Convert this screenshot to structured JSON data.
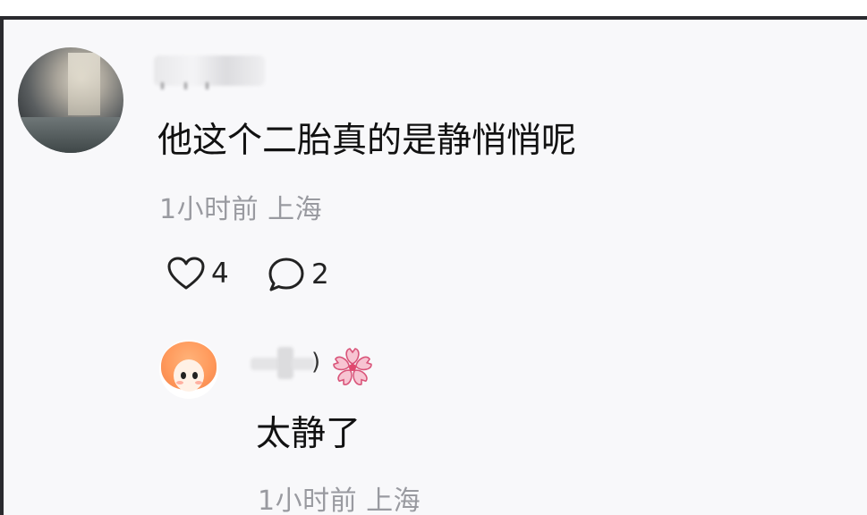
{
  "comment": {
    "text": "他这个二胎真的是静悄悄呢",
    "meta": "1小时前 上海",
    "likes": "4",
    "replies": "2",
    "avatar_icon": "photo-avatar",
    "like_icon": "heart-outline-icon",
    "reply_icon": "speech-bubble-icon"
  },
  "reply": {
    "text": "太静了",
    "meta": "1小时前 上海",
    "avatar_icon": "anime-girl-avatar",
    "badge_icon": "sakura-flower-icon"
  },
  "colors": {
    "text": "#111111",
    "meta": "#999aa0",
    "background": "#f8f8fa",
    "flower_pink": "#f7b7c8",
    "flower_center": "#e0486e"
  }
}
